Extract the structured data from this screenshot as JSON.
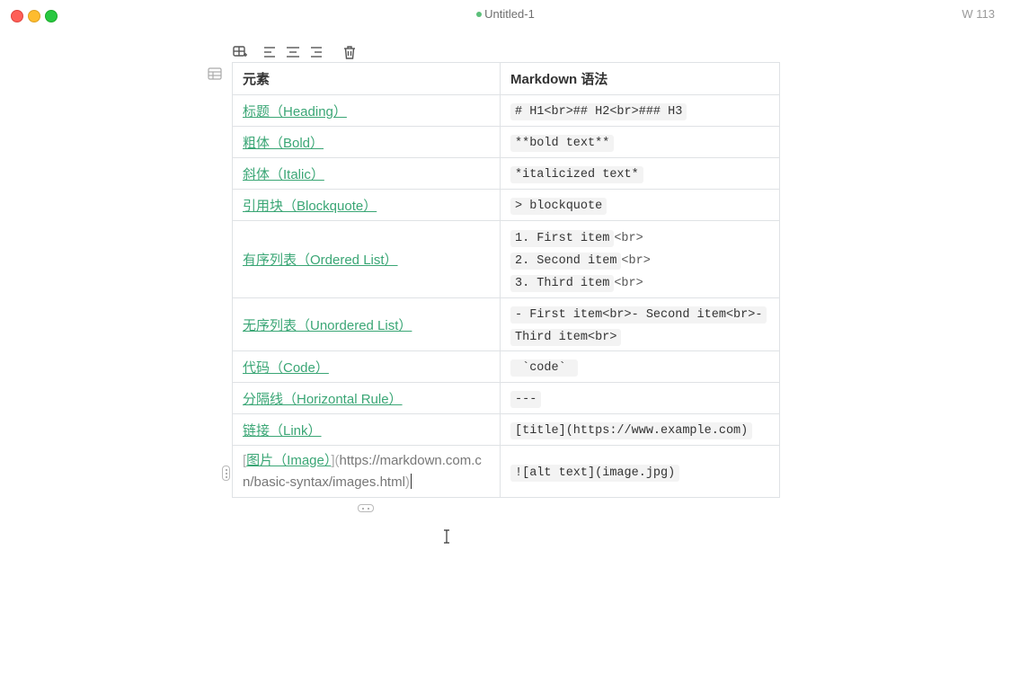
{
  "window": {
    "title": "Untitled-1",
    "word_count": "W 113",
    "colors": {
      "accent": "#3aa675",
      "modified_dot": "#5cbf7a"
    }
  },
  "toolbar": {
    "icons": [
      "table-resize-icon",
      "align-left-icon",
      "align-center-icon",
      "align-right-icon",
      "delete-table-icon"
    ]
  },
  "table": {
    "headers": [
      "元素",
      "Markdown 语法"
    ],
    "rows": [
      {
        "element": "标题（Heading）",
        "syntax": "# H1<br>## H2<br>### H3"
      },
      {
        "element": "粗体（Bold）",
        "syntax": "**bold text**"
      },
      {
        "element": "斜体（Italic）",
        "syntax": "*italicized text*"
      },
      {
        "element": "引用块（Blockquote）",
        "syntax": "> blockquote"
      },
      {
        "element": "有序列表（Ordered List）",
        "syntax_lines": [
          {
            "code": "1. First item",
            "tag": "<br>"
          },
          {
            "code": "2. Second item",
            "tag": "<br>"
          },
          {
            "code": "3. Third item",
            "tag": "<br>"
          }
        ]
      },
      {
        "element": "无序列表（Unordered List）",
        "syntax_line1": "- First item<br>- Second item<br>-",
        "syntax_line2": "Third item<br>"
      },
      {
        "element": "代码（Code）",
        "syntax": " `code` "
      },
      {
        "element": "分隔线（Horizontal Rule）",
        "syntax": "---"
      },
      {
        "element": "链接（Link）",
        "syntax": "[title](https://www.example.com)"
      },
      {
        "element_open": "[",
        "element": "图片（Image）",
        "element_mid": "](",
        "element_url": "https://markdown.com.cn/basic-syntax/images.html",
        "element_close": ")",
        "syntax": "![alt text](image.jpg)"
      }
    ]
  }
}
